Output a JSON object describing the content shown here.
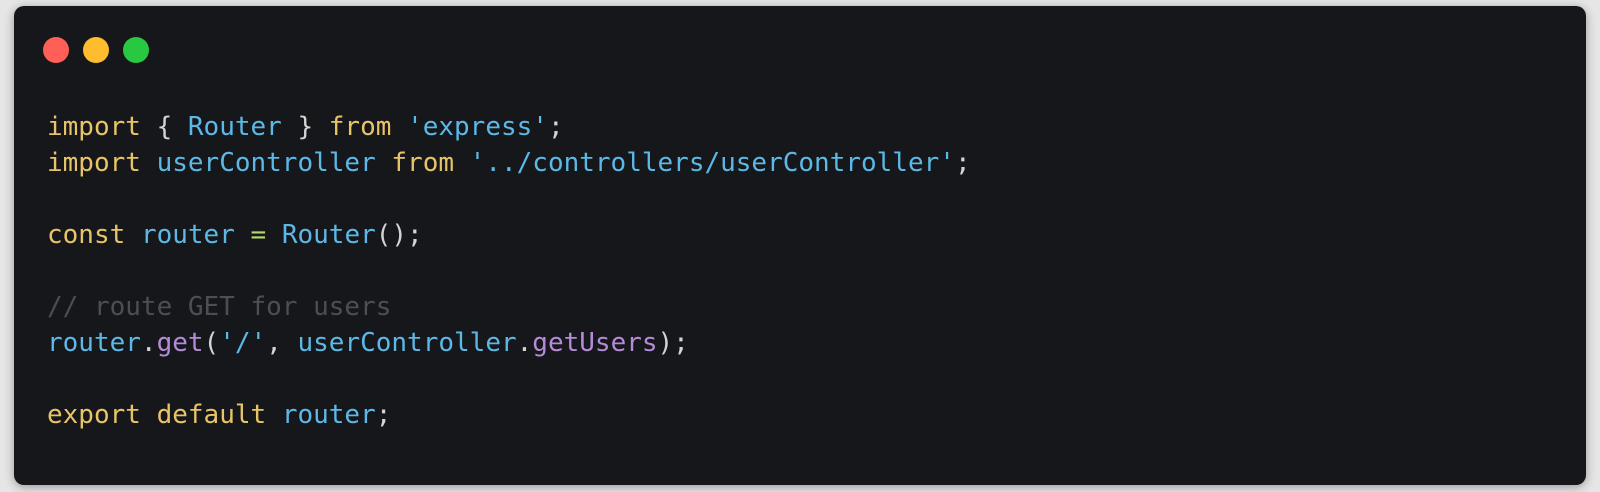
{
  "window": {
    "controls": {
      "close_color": "#ff5f57",
      "minimize_color": "#febc2e",
      "maximize_color": "#28c840"
    }
  },
  "code": {
    "language": "javascript",
    "lines": [
      [
        {
          "t": "import",
          "k": "kw"
        },
        {
          "t": " { ",
          "k": "pn"
        },
        {
          "t": "Router",
          "k": "id"
        },
        {
          "t": " } ",
          "k": "pn"
        },
        {
          "t": "from",
          "k": "kw"
        },
        {
          "t": " ",
          "k": "pn"
        },
        {
          "t": "'express'",
          "k": "str"
        },
        {
          "t": ";",
          "k": "pn"
        }
      ],
      [
        {
          "t": "import",
          "k": "kw"
        },
        {
          "t": " ",
          "k": "pn"
        },
        {
          "t": "userController",
          "k": "id"
        },
        {
          "t": " ",
          "k": "pn"
        },
        {
          "t": "from",
          "k": "kw"
        },
        {
          "t": " ",
          "k": "pn"
        },
        {
          "t": "'../controllers/userController'",
          "k": "str"
        },
        {
          "t": ";",
          "k": "pn"
        }
      ],
      [],
      [
        {
          "t": "const",
          "k": "kw"
        },
        {
          "t": " ",
          "k": "pn"
        },
        {
          "t": "router",
          "k": "id"
        },
        {
          "t": " ",
          "k": "pn"
        },
        {
          "t": "=",
          "k": "op"
        },
        {
          "t": " ",
          "k": "pn"
        },
        {
          "t": "Router",
          "k": "id"
        },
        {
          "t": "();",
          "k": "pn"
        }
      ],
      [],
      [
        {
          "t": "// route GET for users",
          "k": "cm"
        }
      ],
      [
        {
          "t": "router",
          "k": "id"
        },
        {
          "t": ".",
          "k": "pn"
        },
        {
          "t": "get",
          "k": "fn"
        },
        {
          "t": "(",
          "k": "pn"
        },
        {
          "t": "'/'",
          "k": "str"
        },
        {
          "t": ", ",
          "k": "pn"
        },
        {
          "t": "userController",
          "k": "id"
        },
        {
          "t": ".",
          "k": "pn"
        },
        {
          "t": "getUsers",
          "k": "fn"
        },
        {
          "t": ");",
          "k": "pn"
        }
      ],
      [],
      [
        {
          "t": "export",
          "k": "kw"
        },
        {
          "t": " ",
          "k": "pn"
        },
        {
          "t": "default",
          "k": "kw"
        },
        {
          "t": " ",
          "k": "pn"
        },
        {
          "t": "router",
          "k": "id"
        },
        {
          "t": ";",
          "k": "pn"
        }
      ]
    ]
  },
  "theme": {
    "background": "#16171a",
    "keyword": "#e8c468",
    "identifier": "#5cb8e6",
    "string": "#5cb8e6",
    "punctuation": "#d4d4d4",
    "operator": "#b5d96a",
    "method": "#b58ad8",
    "comment": "#4a4f57"
  }
}
